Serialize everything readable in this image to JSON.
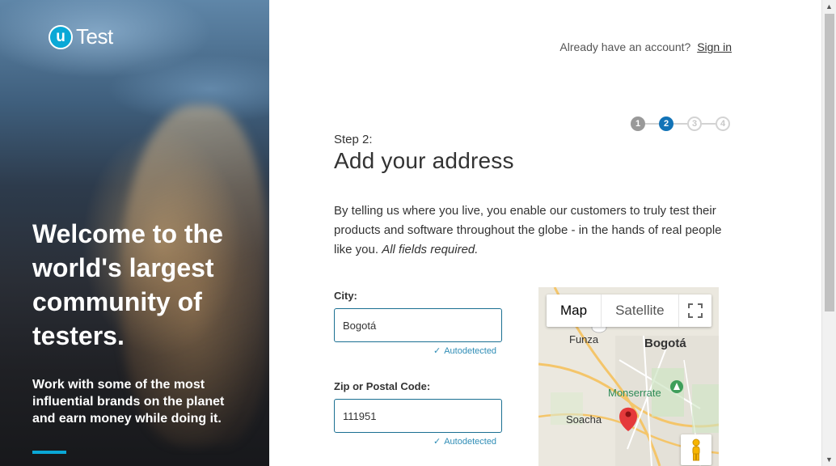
{
  "brand": {
    "logo_letter": "u",
    "logo_text": "Test"
  },
  "hero": {
    "title": "Welcome to the world's largest community of testers.",
    "subtitle": "Work with some of the most influential brands on the planet and earn money while doing it."
  },
  "header": {
    "prompt": "Already have an account?",
    "signin_label": "Sign in"
  },
  "stepper": {
    "steps": [
      "1",
      "2",
      "3",
      "4"
    ],
    "current": 2
  },
  "form": {
    "step_label": "Step 2:",
    "title": "Add your address",
    "intro": "By telling us where you live, you enable our customers to truly test their products and software throughout the globe - in the hands of real people like you.",
    "intro_emphasis": "All fields required.",
    "city": {
      "label": "City:",
      "value": "Bogotá",
      "note": "Autodetected"
    },
    "zip": {
      "label": "Zip or Postal Code:",
      "value": "111951",
      "note": "Autodetected"
    }
  },
  "map": {
    "tabs": [
      "Map",
      "Satellite"
    ],
    "active_tab": "Map",
    "places": {
      "funza": "Funza",
      "bogota": "Bogotá",
      "monserrate": "Monserrate",
      "soacha": "Soacha"
    }
  },
  "colors": {
    "accent": "#0aa8d6",
    "step_active": "#1273b7",
    "input_border": "#1a6f92",
    "pin": "#e5393b"
  }
}
